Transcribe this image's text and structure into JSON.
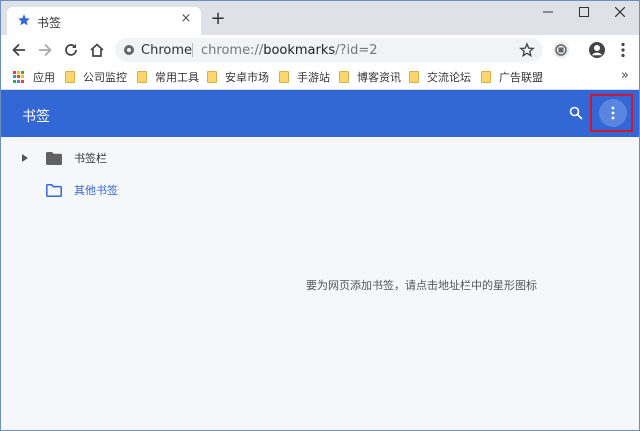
{
  "tab": {
    "title": "书签",
    "close_glyph": "×",
    "new_tab_glyph": "+"
  },
  "toolbar": {
    "omnibox": {
      "scheme_label": "Chrome",
      "url_prefix": "chrome://",
      "url_host": "bookmarks",
      "url_path": "/?id=2"
    }
  },
  "bookmarks_bar": {
    "apps_label": "应用",
    "items": [
      {
        "label": "公司监控"
      },
      {
        "label": "常用工具"
      },
      {
        "label": "安卓市场"
      },
      {
        "label": "手游站"
      },
      {
        "label": "博客资讯"
      },
      {
        "label": "交流论坛"
      },
      {
        "label": "广告联盟"
      }
    ],
    "overflow_glyph": "»"
  },
  "manager": {
    "title": "书签",
    "tree": [
      {
        "label": "书签栏"
      },
      {
        "label": "其他书签"
      }
    ],
    "empty_message": "要为网页添加书签，请点击地址栏中的星形图标"
  },
  "colors": {
    "accent": "#3367d6",
    "highlight": "#d01730"
  }
}
